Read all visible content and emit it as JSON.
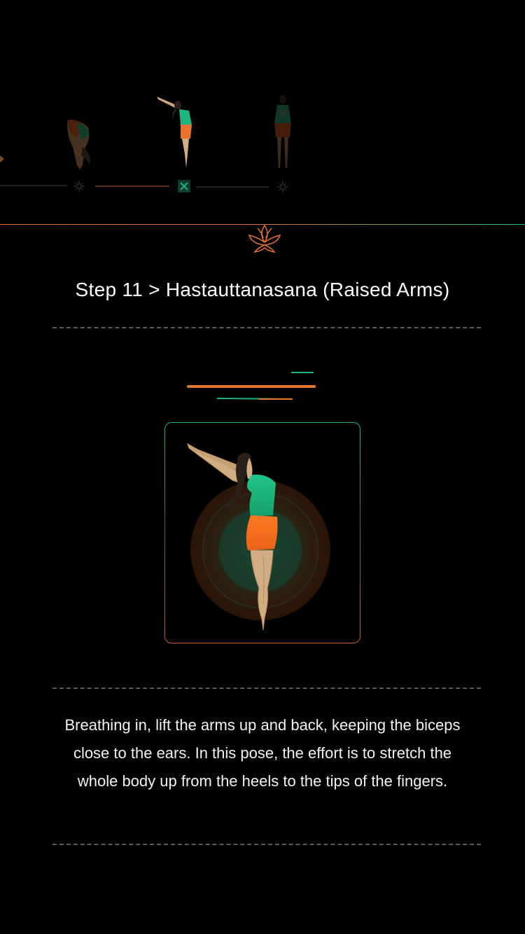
{
  "step": {
    "title": "Step 11 > Hastauttanasana (Raised Arms)"
  },
  "description": "Breathing in, lift the arms up and back, keeping the biceps close to the ears. In this pose, the effort is to stretch the whole body up from the heels to the tips of the fingers.",
  "carousel": {
    "items": [
      {
        "pose": "forward-bend",
        "state": "previous"
      },
      {
        "pose": "raised-arms",
        "state": "active"
      },
      {
        "pose": "prayer",
        "state": "next"
      }
    ]
  },
  "colors": {
    "background": "#000000",
    "accent_orange": "#e8722c",
    "accent_green": "#22c48a",
    "skin": "#d2ad83",
    "hair": "#2b2018"
  },
  "icons": [
    "lotus-icon",
    "carousel-marker-icon"
  ]
}
